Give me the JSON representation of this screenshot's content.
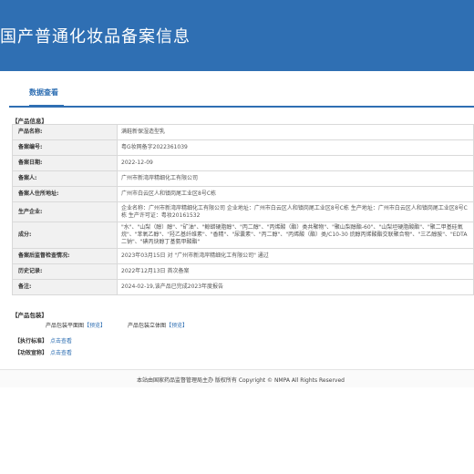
{
  "banner": {
    "title": "国产普通化妆品备案信息"
  },
  "tabs": [
    {
      "label": "数据查看"
    }
  ],
  "product_info": {
    "section_title": "【产品信息】",
    "rows": [
      {
        "label": "产品名称:",
        "value": "满鞋新保湿造型乳"
      },
      {
        "label": "备案编号:",
        "value": "粤G妆网备字2022361039"
      },
      {
        "label": "备案日期:",
        "value": "2022-12-09"
      },
      {
        "label": "备案人:",
        "value": "广州市新湾岸精细化工有限公司"
      },
      {
        "label": "备案人住所地址:",
        "value": "广州市白云区人和镇岗尾工业区8号C栋"
      },
      {
        "label": "生产企业:",
        "value": "企业名称：广州市新湾岸精细化工有限公司 企业地址：广州市白云区人和镇岗尾工业区8号C栋 生产地址：广州市白云区人和镇岗尾工业区8号C栋 生产许可证：粤妆20161532"
      },
      {
        "label": "成分:",
        "value": "\"水\"、\"山梨（醇）醇\"、\"矿油\"、\"鲸蜡硬脂醇\"、\"丙二醇\"、\"丙烯酸（酯）类共聚物\"、\"聚山梨醇酯-60\"、\"山梨坦硬脂酸酯\"、\"聚二甲基硅氧烷\"、\"苯氧乙醇\"、\"羟乙基纤维素\"、\"香精\"、\"尿囊素\"、\"丙二醇\"、\"丙烯酸（酯）类/C10-30 烷醇丙烯酸酯交联聚合物\"、\"三乙醇胺\"、\"EDTA 二钠\"、\"碘丙炔醇丁基氨甲酸酯\""
      },
      {
        "label": "备案后监督检查情况:",
        "value": "2023年03月15日 对 \"广州市新湾岸精细化工有限公司\" 通过"
      },
      {
        "label": "历史记录:",
        "value": "2022年12月13日 首次备案"
      },
      {
        "label": "备注:",
        "value": "2024-02-19,该产品已完成2023年度报告"
      }
    ]
  },
  "packaging": {
    "section_title": "【产品包装】",
    "items": [
      {
        "label": "产品包装平面图",
        "link": "【预览】"
      },
      {
        "label": "产品包装立体图",
        "link": "【预览】"
      }
    ]
  },
  "standard": {
    "label": "【执行标准】",
    "link": "点击查看"
  },
  "efficacy": {
    "label": "【功效宣称】",
    "link": "点击查看"
  },
  "footer": {
    "text": "本站由国家药品监督管理局主办 版权所有 Copyright © NMPA All Rights Reserved"
  },
  "colors": {
    "primary": "#2f6fb3",
    "label_bg": "#f1f1f1",
    "border": "#d9d9d9"
  }
}
